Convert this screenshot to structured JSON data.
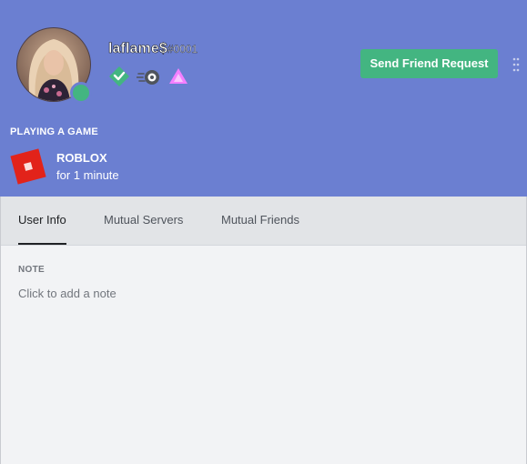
{
  "profile": {
    "username": "laflame$",
    "discriminator": "#0001",
    "status_color": "#43b581",
    "avatar_icon": "avatar-photo",
    "badges": [
      {
        "name": "hypesquad-badge",
        "color": "#43b581"
      },
      {
        "name": "nitro-badge",
        "color": "#4f545c"
      },
      {
        "name": "early-supporter-badge",
        "color": "#f47fff"
      }
    ]
  },
  "actions": {
    "send_friend_request": "Send Friend Request"
  },
  "activity": {
    "label": "PLAYING A GAME",
    "game_name": "ROBLOX",
    "duration": "for 1 minute",
    "game_icon": "roblox-icon",
    "game_icon_color": "#e2231a"
  },
  "tabs": [
    {
      "label": "User Info",
      "active": true
    },
    {
      "label": "Mutual Servers",
      "active": false
    },
    {
      "label": "Mutual Friends",
      "active": false
    }
  ],
  "note": {
    "label": "NOTE",
    "placeholder": "Click to add a note"
  },
  "colors": {
    "header_bg": "#6b7fd1",
    "button_green": "#43b581",
    "body_bg": "#f2f3f5",
    "tabbar_bg": "#e2e4e7"
  }
}
